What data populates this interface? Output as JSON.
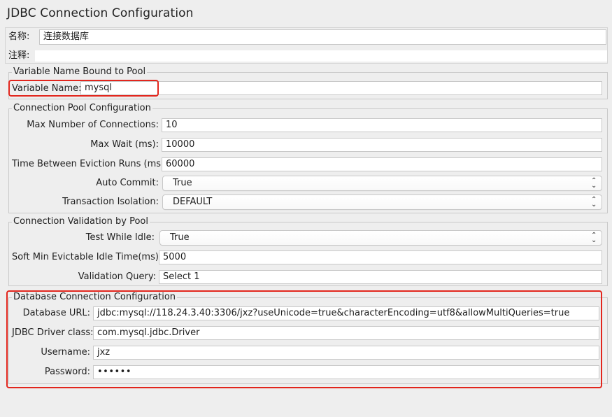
{
  "window": {
    "title": "JDBC Connection Configuration"
  },
  "top": {
    "name_label": "名称:",
    "name_value": "连接数据库",
    "comment_label": "注释:",
    "comment_value": ""
  },
  "sections": {
    "variable": {
      "title": "Variable Name Bound to Pool",
      "label": "Variable Name:",
      "value": "mysql"
    },
    "pool": {
      "title": "Connection Pool Configuration",
      "max_connections_label": "Max Number of Connections:",
      "max_connections_value": "10",
      "max_wait_label": "Max Wait (ms):",
      "max_wait_value": "10000",
      "eviction_label": "Time Between Eviction Runs (ms):",
      "eviction_value": "60000",
      "auto_commit_label": "Auto Commit:",
      "auto_commit_value": "True",
      "transaction_isolation_label": "Transaction Isolation:",
      "transaction_isolation_value": "DEFAULT"
    },
    "validation": {
      "title": "Connection Validation by Pool",
      "test_idle_label": "Test While Idle:",
      "test_idle_value": "True",
      "soft_min_label": "Soft Min Evictable Idle Time(ms):",
      "soft_min_value": "5000",
      "validation_query_label": "Validation Query:",
      "validation_query_value": "Select 1"
    },
    "database": {
      "title": "Database Connection Configuration",
      "url_label": "Database URL:",
      "url_value": "jdbc:mysql://118.24.3.40:3306/jxz?useUnicode=true&characterEncoding=utf8&allowMultiQueries=true",
      "driver_label": "JDBC Driver class:",
      "driver_value": "com.mysql.jdbc.Driver",
      "username_label": "Username:",
      "username_value": "jxz",
      "password_label": "Password:",
      "password_value": "••••••"
    }
  },
  "icons": {
    "select_arrow": "updown-chevron-icon"
  },
  "colors": {
    "highlight": "#e2261d",
    "background": "#eeeeee",
    "field": "#ffffff",
    "border": "#c9c9c9"
  }
}
